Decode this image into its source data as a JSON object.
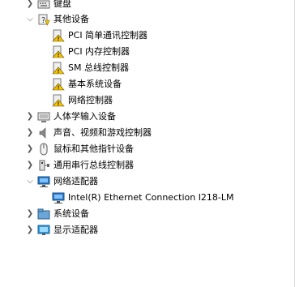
{
  "tree": {
    "items": [
      {
        "label": "键盘",
        "icon": "keyboard-icon",
        "expanded": false
      },
      {
        "label": "其他设备",
        "icon": "unknown-device-icon",
        "expanded": true
      },
      {
        "label": "PCI 简单通讯控制器",
        "icon": "warning-device-icon"
      },
      {
        "label": "PCI 内存控制器",
        "icon": "warning-device-icon"
      },
      {
        "label": "SM 总线控制器",
        "icon": "warning-device-icon"
      },
      {
        "label": "基本系统设备",
        "icon": "warning-device-icon"
      },
      {
        "label": "网络控制器",
        "icon": "warning-device-icon"
      },
      {
        "label": "人体学输入设备",
        "icon": "hid-icon",
        "expanded": false
      },
      {
        "label": "声音、视频和游戏控制器",
        "icon": "speaker-icon",
        "expanded": false
      },
      {
        "label": "鼠标和其他指针设备",
        "icon": "mouse-icon",
        "expanded": false
      },
      {
        "label": "通用串行总线控制器",
        "icon": "usb-icon",
        "expanded": false
      },
      {
        "label": "网络适配器",
        "icon": "network-adapter-icon",
        "expanded": true
      },
      {
        "label": "Intel(R) Ethernet Connection I218-LM",
        "icon": "network-adapter-icon"
      },
      {
        "label": "系统设备",
        "icon": "system-folder-icon",
        "expanded": false
      },
      {
        "label": "显示适配器",
        "icon": "monitor-icon",
        "expanded": false
      }
    ]
  },
  "colors": {
    "warning": "#f5c400",
    "network": "#2a78c7",
    "monitor": "#2e9be0"
  }
}
